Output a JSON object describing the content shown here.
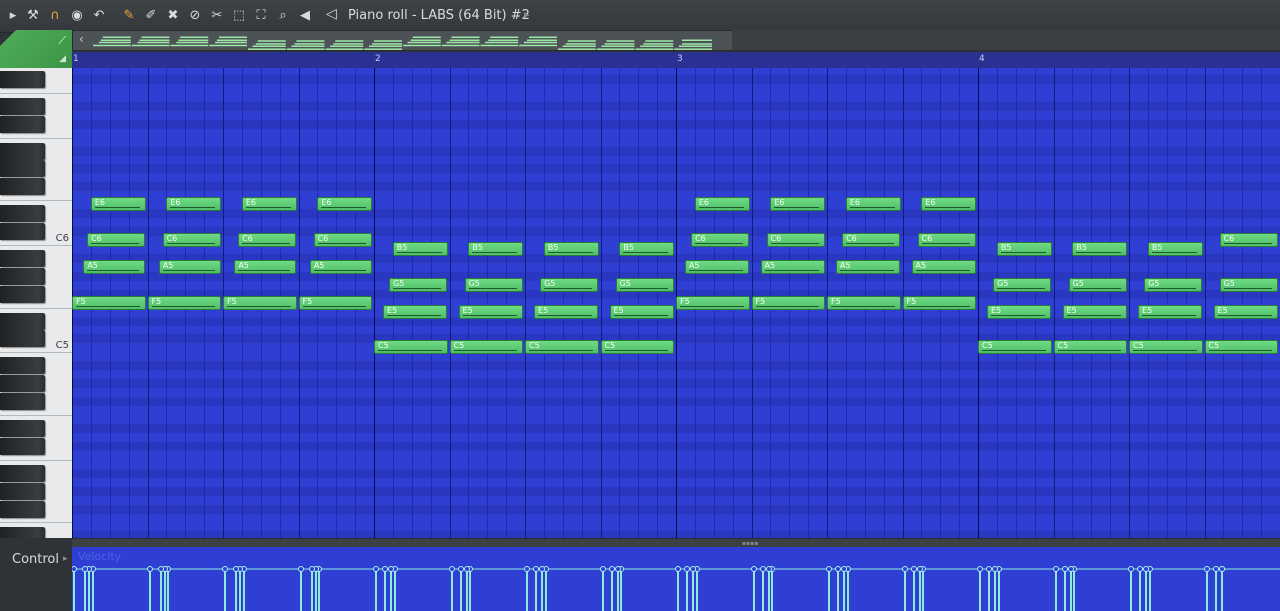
{
  "window": {
    "title": "Piano roll - LABS (64 Bit) #2"
  },
  "toolbar": {
    "icons": [
      "menu-arrow-icon",
      "wrench-icon",
      "magnet-icon",
      "stamp-icon",
      "undo-icon",
      "pencil-icon",
      "paint-brush-icon",
      "delete-icon",
      "mute-icon",
      "slice-icon",
      "select-icon",
      "zoom-icon",
      "speaker-icon"
    ]
  },
  "control": {
    "label": "Control",
    "parameter": "Velocity"
  },
  "timeline": {
    "bars": [
      "1",
      "2",
      "3",
      "4"
    ]
  },
  "keyboard": {
    "labels": [
      "C6",
      "C5"
    ]
  },
  "colors": {
    "grid": "#2f3fd4",
    "note": "#5ccf73",
    "snap_tab": "#4fae59",
    "velocity": "#8fe9d8"
  },
  "notes": [
    {
      "pitch": "E6",
      "start": 0.25,
      "length": 0.75
    },
    {
      "pitch": "E6",
      "start": 1.25,
      "length": 0.75
    },
    {
      "pitch": "E6",
      "start": 2.25,
      "length": 0.75
    },
    {
      "pitch": "E6",
      "start": 3.25,
      "length": 0.75
    },
    {
      "pitch": "C6",
      "start": 0.2,
      "length": 0.8
    },
    {
      "pitch": "C6",
      "start": 1.2,
      "length": 0.8
    },
    {
      "pitch": "C6",
      "start": 2.2,
      "length": 0.8
    },
    {
      "pitch": "C6",
      "start": 3.2,
      "length": 0.8
    },
    {
      "pitch": "A5",
      "start": 0.15,
      "length": 0.85
    },
    {
      "pitch": "A5",
      "start": 1.15,
      "length": 0.85
    },
    {
      "pitch": "A5",
      "start": 2.15,
      "length": 0.85
    },
    {
      "pitch": "A5",
      "start": 3.15,
      "length": 0.85
    },
    {
      "pitch": "F5",
      "start": 0,
      "length": 1
    },
    {
      "pitch": "F5",
      "start": 1,
      "length": 1
    },
    {
      "pitch": "F5",
      "start": 2,
      "length": 1
    },
    {
      "pitch": "F5",
      "start": 3,
      "length": 1
    },
    {
      "pitch": "B5",
      "start": 4.25,
      "length": 0.75
    },
    {
      "pitch": "B5",
      "start": 5.25,
      "length": 0.75
    },
    {
      "pitch": "B5",
      "start": 6.25,
      "length": 0.75
    },
    {
      "pitch": "B5",
      "start": 7.25,
      "length": 0.75
    },
    {
      "pitch": "G5",
      "start": 4.2,
      "length": 0.8
    },
    {
      "pitch": "G5",
      "start": 5.2,
      "length": 0.8
    },
    {
      "pitch": "G5",
      "start": 6.2,
      "length": 0.8
    },
    {
      "pitch": "G5",
      "start": 7.2,
      "length": 0.8
    },
    {
      "pitch": "E5",
      "start": 4.12,
      "length": 0.88
    },
    {
      "pitch": "E5",
      "start": 5.12,
      "length": 0.88
    },
    {
      "pitch": "E5",
      "start": 6.12,
      "length": 0.88
    },
    {
      "pitch": "E5",
      "start": 7.12,
      "length": 0.88
    },
    {
      "pitch": "C5",
      "start": 4,
      "length": 1
    },
    {
      "pitch": "C5",
      "start": 5,
      "length": 1
    },
    {
      "pitch": "C5",
      "start": 6,
      "length": 1
    },
    {
      "pitch": "C5",
      "start": 7,
      "length": 1
    },
    {
      "pitch": "E6",
      "start": 8.25,
      "length": 0.75
    },
    {
      "pitch": "E6",
      "start": 9.25,
      "length": 0.75
    },
    {
      "pitch": "E6",
      "start": 10.25,
      "length": 0.75
    },
    {
      "pitch": "E6",
      "start": 11.25,
      "length": 0.75
    },
    {
      "pitch": "C6",
      "start": 8.2,
      "length": 0.8
    },
    {
      "pitch": "C6",
      "start": 9.2,
      "length": 0.8
    },
    {
      "pitch": "C6",
      "start": 10.2,
      "length": 0.8
    },
    {
      "pitch": "C6",
      "start": 11.2,
      "length": 0.8
    },
    {
      "pitch": "A5",
      "start": 8.12,
      "length": 0.88
    },
    {
      "pitch": "A5",
      "start": 9.12,
      "length": 0.88
    },
    {
      "pitch": "A5",
      "start": 10.12,
      "length": 0.88
    },
    {
      "pitch": "A5",
      "start": 11.12,
      "length": 0.88
    },
    {
      "pitch": "F5",
      "start": 8,
      "length": 1
    },
    {
      "pitch": "F5",
      "start": 9,
      "length": 1
    },
    {
      "pitch": "F5",
      "start": 10,
      "length": 1
    },
    {
      "pitch": "F5",
      "start": 11,
      "length": 1
    },
    {
      "pitch": "B5",
      "start": 12.25,
      "length": 0.75
    },
    {
      "pitch": "B5",
      "start": 13.25,
      "length": 0.75
    },
    {
      "pitch": "B5",
      "start": 14.25,
      "length": 0.75
    },
    {
      "pitch": "C6",
      "start": 15.2,
      "length": 0.8
    },
    {
      "pitch": "G5",
      "start": 12.2,
      "length": 0.8
    },
    {
      "pitch": "G5",
      "start": 13.2,
      "length": 0.8
    },
    {
      "pitch": "G5",
      "start": 14.2,
      "length": 0.8
    },
    {
      "pitch": "G5",
      "start": 15.2,
      "length": 0.8
    },
    {
      "pitch": "E5",
      "start": 12.12,
      "length": 0.88
    },
    {
      "pitch": "E5",
      "start": 13.12,
      "length": 0.88
    },
    {
      "pitch": "E5",
      "start": 14.12,
      "length": 0.88
    },
    {
      "pitch": "E5",
      "start": 15.12,
      "length": 0.88
    },
    {
      "pitch": "C5",
      "start": 12,
      "length": 1
    },
    {
      "pitch": "C5",
      "start": 13,
      "length": 1
    },
    {
      "pitch": "C5",
      "start": 14,
      "length": 1
    },
    {
      "pitch": "C5",
      "start": 15,
      "length": 1
    }
  ]
}
